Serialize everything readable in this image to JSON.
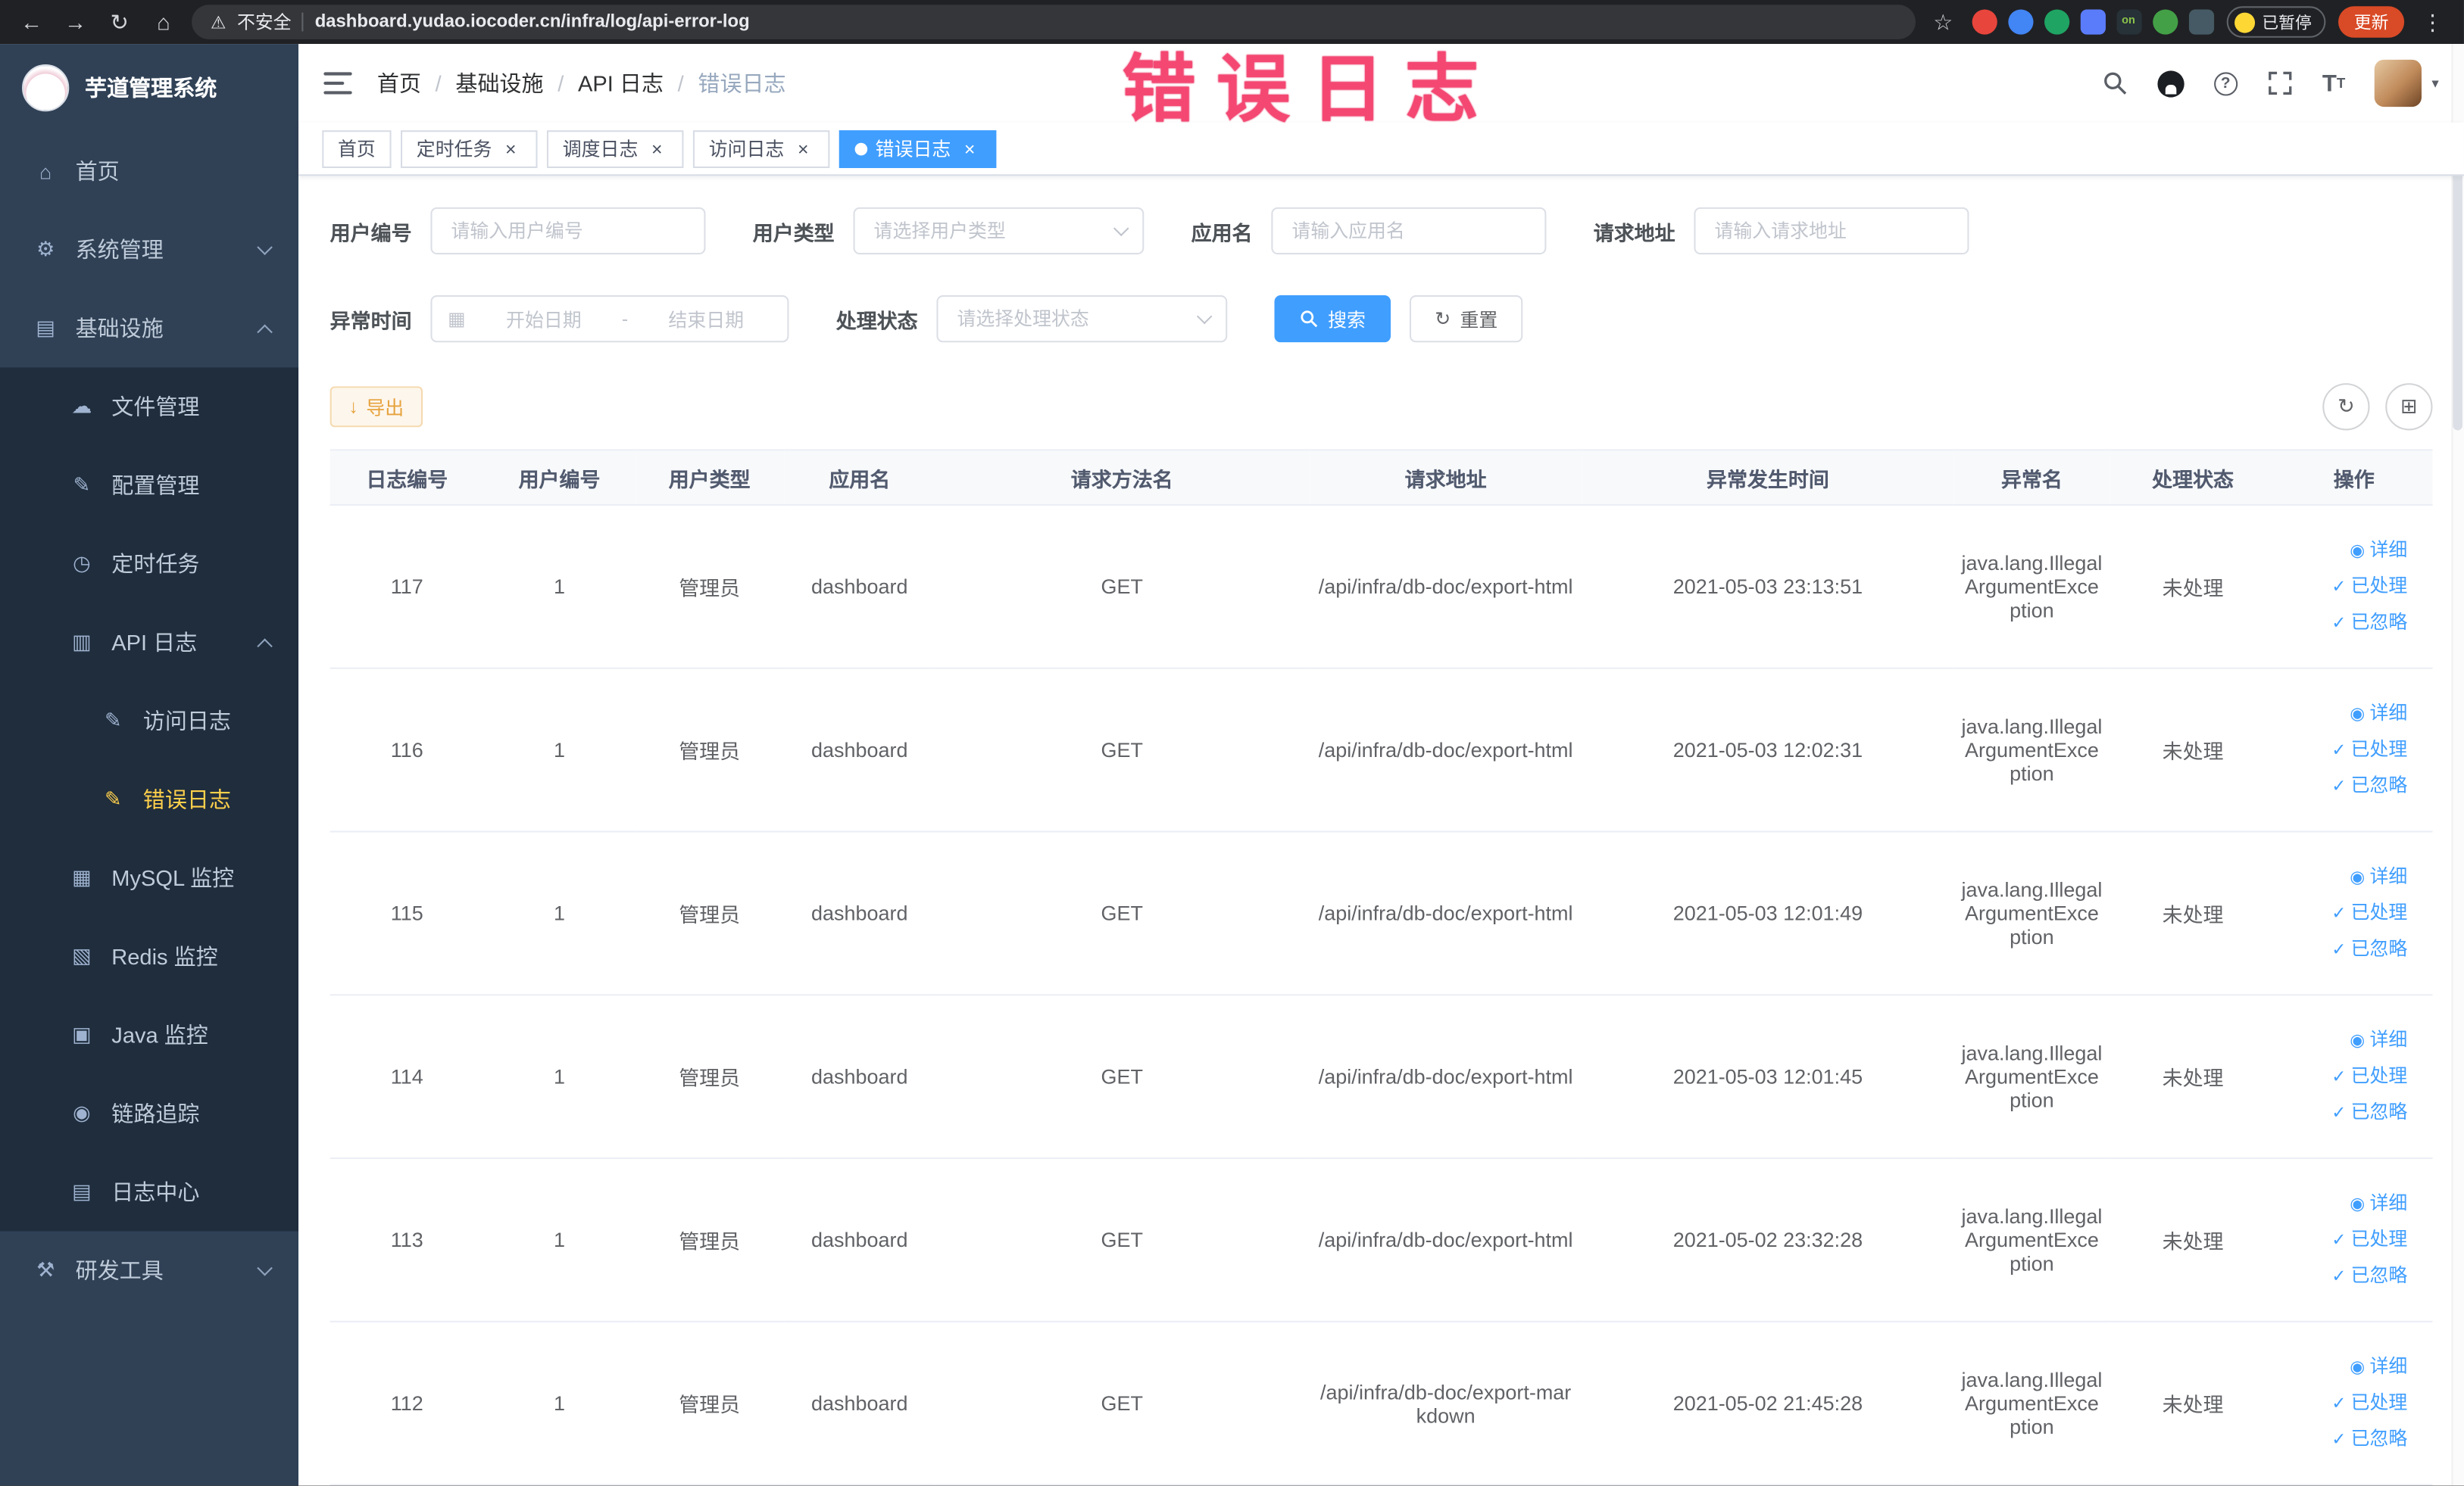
{
  "colors": {
    "primary": "#409eff",
    "warning_text": "#e6a23c",
    "sidebar_bg": "#304156",
    "submenu_bg": "#1f2d3d",
    "active_menu_text": "#ffd04b",
    "stamp": "#f43f6b",
    "tag_active_bg": "#409eff"
  },
  "stamp_text": "错误日志",
  "browser": {
    "back_glyph": "←",
    "forward_glyph": "→",
    "reload_glyph": "↻",
    "home_glyph": "⌂",
    "warning_glyph": "⚠",
    "security_label": "不安全",
    "url": "dashboard.yudao.iocoder.cn/infra/log/api-error-log",
    "bookmark_star_glyph": "☆",
    "paused_chip_label": "已暂停",
    "update_button_label": "更新",
    "menu_dots_glyph": "⋮",
    "extensions": [
      {
        "name": "extension-red-circle",
        "style": "background:#e8453c;border-radius:50%",
        "label": ""
      },
      {
        "name": "extension-blue-circle",
        "style": "background:#4285f4;border-radius:50%",
        "label": ""
      },
      {
        "name": "extension-green-circle",
        "style": "background:#1fa463;border-radius:50%",
        "label": ""
      },
      {
        "name": "extension-blue-square",
        "style": "background:#5b7cfa;border-radius:4px",
        "label": ""
      },
      {
        "name": "extension-on-badge",
        "style": "background:#263238;border-radius:4px;color:#8bc34a;font-size:7px;line-height:16px;text-align:center",
        "label": "on"
      },
      {
        "name": "extension-green-leaf",
        "style": "background:#43a047;border-radius:50%",
        "label": ""
      },
      {
        "name": "extension-dark-square",
        "style": "background:#455a64;border-radius:4px",
        "label": ""
      }
    ]
  },
  "sidebar": {
    "logo_title": "芋道管理系统",
    "items": [
      {
        "label": "首页",
        "glyph": "⌂"
      },
      {
        "label": "系统管理",
        "glyph": "⚙"
      },
      {
        "label": "基础设施",
        "glyph": "▤"
      },
      {
        "label": "文件管理",
        "glyph": "☁"
      },
      {
        "label": "配置管理",
        "glyph": "✎"
      },
      {
        "label": "定时任务",
        "glyph": "◷"
      },
      {
        "label": "API 日志",
        "glyph": "▥"
      },
      {
        "label": "访问日志",
        "glyph": "✎"
      },
      {
        "label": "错误日志",
        "glyph": "✎"
      },
      {
        "label": "MySQL 监控",
        "glyph": "▦"
      },
      {
        "label": "Redis 监控",
        "glyph": "▧"
      },
      {
        "label": "Java 监控",
        "glyph": "▣"
      },
      {
        "label": "链路追踪",
        "glyph": "◉"
      },
      {
        "label": "日志中心",
        "glyph": "▤"
      },
      {
        "label": "研发工具",
        "glyph": "⚒"
      }
    ]
  },
  "navbar": {
    "breadcrumb": [
      "首页",
      "基础设施",
      "API 日志",
      "错误日志"
    ],
    "separator": "/",
    "help_glyph": "?"
  },
  "ui": {
    "close_glyph": "×",
    "caret_glyph": "▾"
  },
  "tags": [
    {
      "label": "首页"
    },
    {
      "label": "定时任务"
    },
    {
      "label": "调度日志"
    },
    {
      "label": "访问日志"
    },
    {
      "label": "错误日志"
    }
  ],
  "filters": {
    "user_id_label": "用户编号",
    "user_id_placeholder": "请输入用户编号",
    "user_type_label": "用户类型",
    "user_type_placeholder": "请选择用户类型",
    "app_name_label": "应用名",
    "app_name_placeholder": "请输入应用名",
    "request_url_label": "请求地址",
    "request_url_placeholder": "请输入请求地址",
    "exception_time_label": "异常时间",
    "date_start_placeholder": "开始日期",
    "date_separator": "-",
    "date_end_placeholder": "结束日期",
    "process_status_label": "处理状态",
    "process_status_placeholder": "请选择处理状态",
    "search_button": "搜索",
    "reset_button": "重置",
    "reset_glyph": "↻",
    "calendar_glyph": "▦"
  },
  "toolbar": {
    "export_button": "导出",
    "export_glyph": "↓",
    "refresh_glyph": "↻",
    "grid_glyph": "⊞"
  },
  "table": {
    "columns": [
      "日志编号",
      "用户编号",
      "用户类型",
      "应用名",
      "请求方法名",
      "请求地址",
      "异常发生时间",
      "异常名",
      "处理状态",
      "操作"
    ],
    "actions": [
      {
        "glyph": "◉",
        "label": "详细"
      },
      {
        "glyph": "✓",
        "label": "已处理"
      },
      {
        "glyph": "✓",
        "label": "已忽略"
      }
    ],
    "rows": [
      {
        "id": "117",
        "user_id": "1",
        "user_type": "管理员",
        "app": "dashboard",
        "method": "GET",
        "url": "/api/infra/db-doc/export-html",
        "time": "2021-05-03 23:13:51",
        "exception": "java.lang.IllegalArgumentException",
        "status": "未处理"
      },
      {
        "id": "116",
        "user_id": "1",
        "user_type": "管理员",
        "app": "dashboard",
        "method": "GET",
        "url": "/api/infra/db-doc/export-html",
        "time": "2021-05-03 12:02:31",
        "exception": "java.lang.IllegalArgumentException",
        "status": "未处理"
      },
      {
        "id": "115",
        "user_id": "1",
        "user_type": "管理员",
        "app": "dashboard",
        "method": "GET",
        "url": "/api/infra/db-doc/export-html",
        "time": "2021-05-03 12:01:49",
        "exception": "java.lang.IllegalArgumentException",
        "status": "未处理"
      },
      {
        "id": "114",
        "user_id": "1",
        "user_type": "管理员",
        "app": "dashboard",
        "method": "GET",
        "url": "/api/infra/db-doc/export-html",
        "time": "2021-05-03 12:01:45",
        "exception": "java.lang.IllegalArgumentException",
        "status": "未处理"
      },
      {
        "id": "113",
        "user_id": "1",
        "user_type": "管理员",
        "app": "dashboard",
        "method": "GET",
        "url": "/api/infra/db-doc/export-html",
        "time": "2021-05-02 23:32:28",
        "exception": "java.lang.IllegalArgumentException",
        "status": "未处理"
      },
      {
        "id": "112",
        "user_id": "1",
        "user_type": "管理员",
        "app": "dashboard",
        "method": "GET",
        "url": "/api/infra/db-doc/export-markdown",
        "time": "2021-05-02 21:45:28",
        "exception": "java.lang.IllegalArgumentException",
        "status": "未处理"
      }
    ]
  }
}
